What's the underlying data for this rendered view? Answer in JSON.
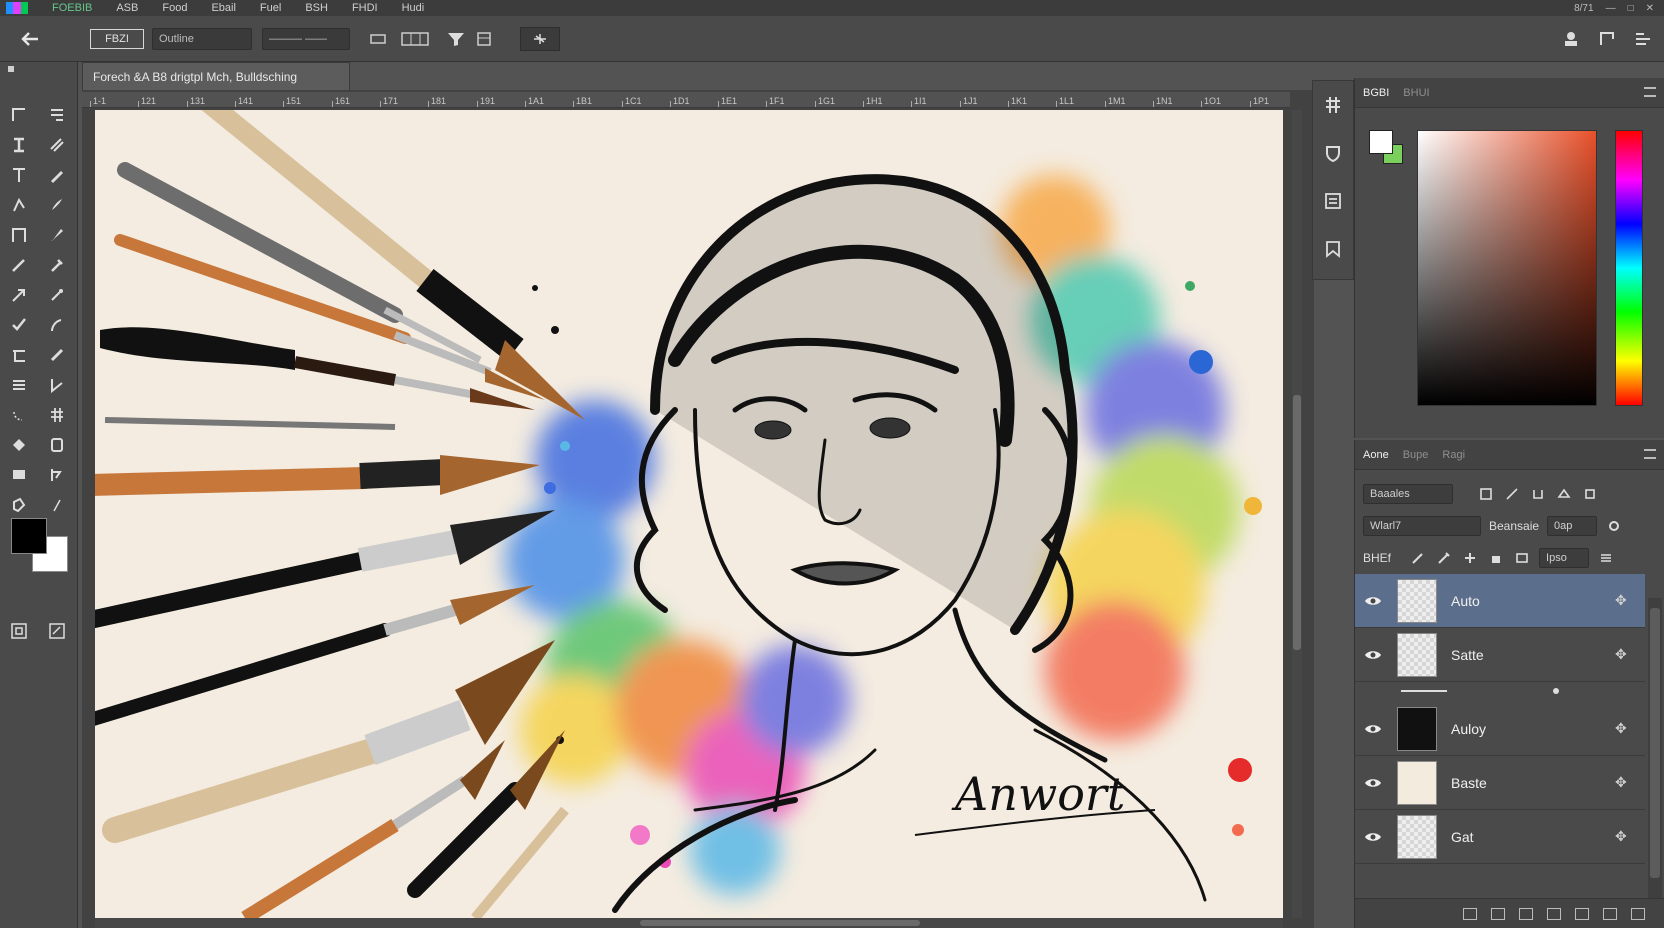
{
  "menubar": {
    "brand": "FOEBIB",
    "items": [
      "ASB",
      "Food",
      "Ebail",
      "Fuel",
      "BSH",
      "FHDI",
      "Hudi"
    ],
    "right": [
      "8/71",
      "—",
      "□",
      "✕"
    ]
  },
  "options": {
    "back_icon": "back-arrow-icon",
    "mode_label": "FBZI",
    "preset_value": "Outline",
    "size_value": "——— ——"
  },
  "document": {
    "tab_title": "Forech &A B8 drigtpl Mch, Bulldsching",
    "ruler_ticks": [
      "1-1",
      "121",
      "131",
      "141",
      "151",
      "161",
      "171",
      "181",
      "191",
      "1A1",
      "1B1",
      "1C1",
      "1D1",
      "1E1",
      "1F1",
      "1G1",
      "1H1",
      "1I1",
      "1J1",
      "1K1",
      "1L1",
      "1M1",
      "1N1",
      "1O1",
      "1P1"
    ],
    "signature": "Anwort"
  },
  "color_panel": {
    "tabs": [
      "BGBI",
      "BHUI"
    ],
    "accent_hue": "#e8502a",
    "bg_swatch": "#7bcf5c"
  },
  "layers_panel": {
    "tabs": [
      "Aone",
      "Bupe",
      "Ragi"
    ],
    "blend_mode": "Baaales",
    "opacity_label": "Wlarl7",
    "fill_label": "Beansaie",
    "fill_value": "0ap",
    "lock_label": "BHEf",
    "lock_value": "Ipso",
    "layers": [
      {
        "name": "Auto",
        "thumb": "checker",
        "selected": true
      },
      {
        "name": "Satte",
        "thumb": "checker",
        "selected": false
      },
      {
        "name": "Auloy",
        "thumb": "dark",
        "selected": false
      },
      {
        "name": "Baste",
        "thumb": "paper",
        "selected": false
      },
      {
        "name": "Gat",
        "thumb": "checker",
        "selected": false
      }
    ]
  }
}
